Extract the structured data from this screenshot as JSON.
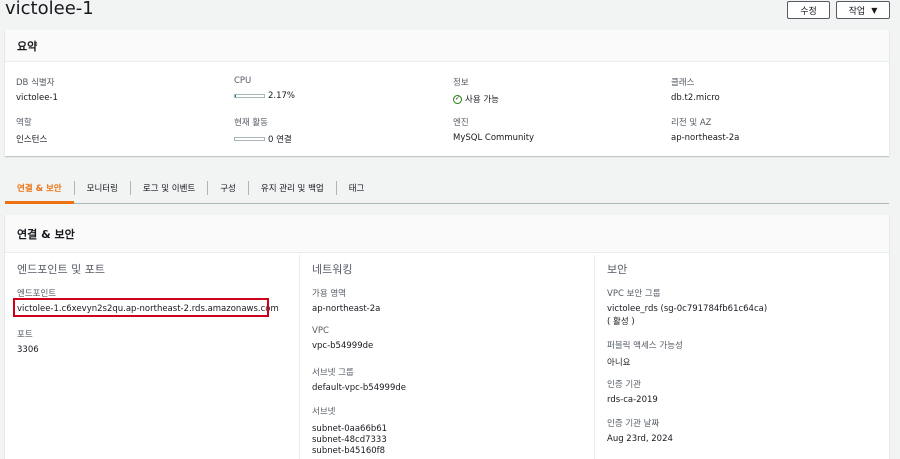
{
  "page": {
    "title": "victolee-1"
  },
  "toolbar": {
    "edit_label": "수정",
    "actions_label": "작업",
    "actions_caret": "▼"
  },
  "summary": {
    "heading": "요약",
    "fields": {
      "db_id_label": "DB 식별자",
      "db_id_value": "victolee-1",
      "cpu_label": "CPU",
      "cpu_value": "2.17%",
      "cpu_fraction": 0.0217,
      "status_label": "정보",
      "status_value": "사용 가능",
      "class_label": "클래스",
      "class_value": "db.t2.micro",
      "role_label": "역할",
      "role_value": "인스턴스",
      "activity_label": "현재 활동",
      "activity_value": "0 연결",
      "activity_fraction": 0,
      "engine_label": "엔진",
      "engine_value": "MySQL Community",
      "region_label": "리전 및 AZ",
      "region_value": "ap-northeast-2a"
    }
  },
  "tabs": [
    {
      "label": "연결 & 보안",
      "active": true
    },
    {
      "label": "모니터링",
      "active": false
    },
    {
      "label": "로그 및 이벤트",
      "active": false
    },
    {
      "label": "구성",
      "active": false
    },
    {
      "label": "유지 관리 및 백업",
      "active": false
    },
    {
      "label": "태그",
      "active": false
    }
  ],
  "connectivity": {
    "heading": "연결 & 보안",
    "endpoint_col": {
      "title": "엔드포인트 및 포트",
      "endpoint_label": "엔드포인트",
      "endpoint_value": "victolee-1.c6xevyn2s2qu.ap-northeast-2.rds.amazonaws.com",
      "port_label": "포트",
      "port_value": "3306"
    },
    "network_col": {
      "title": "네트워킹",
      "az_label": "가용 영역",
      "az_value": "ap-northeast-2a",
      "vpc_label": "VPC",
      "vpc_value": "vpc-b54999de",
      "subnet_group_label": "서브넷 그룹",
      "subnet_group_value": "default-vpc-b54999de",
      "subnets_label": "서브넷",
      "subnets": [
        "subnet-0aa66b61",
        "subnet-48cd7333",
        "subnet-b45160f8"
      ]
    },
    "security_col": {
      "title": "보안",
      "sg_label": "VPC 보안 그룹",
      "sg_value": "victolee_rds (sg-0c791784fb61c64ca)",
      "sg_status": "( 활성 )",
      "public_label": "퍼블릭 액세스 가능성",
      "public_value": "아니요",
      "ca_label": "인증 기관",
      "ca_value": "rds-ca-2019",
      "ca_date_label": "인증 기관 날짜",
      "ca_date_value": "Aug 23rd, 2024"
    }
  },
  "colors": {
    "accent": "#ec7211",
    "link": "#0073bb",
    "success": "#1d8102",
    "highlight": "#d0021b"
  }
}
